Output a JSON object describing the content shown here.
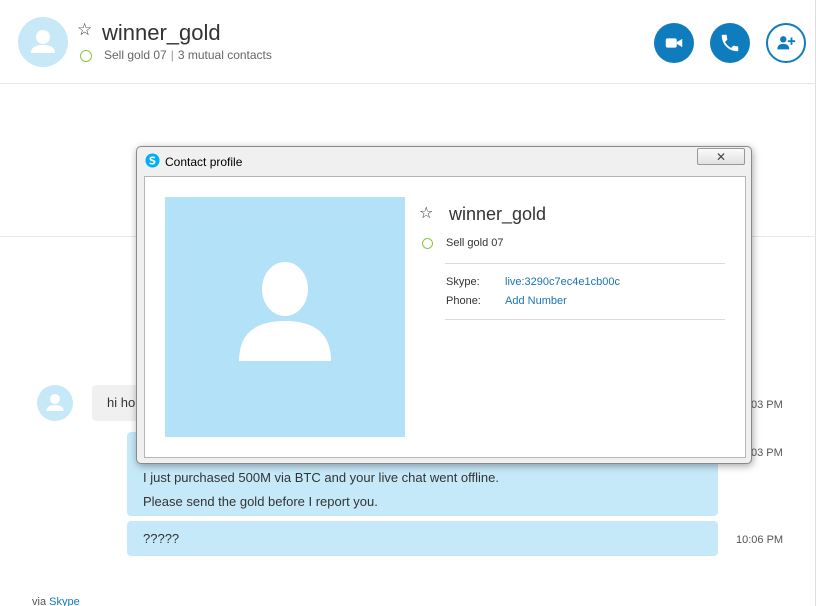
{
  "header": {
    "contact_name": "winner_gold",
    "mood": "Sell gold 07",
    "separator": "|",
    "mutual_contacts": "3 mutual contacts",
    "buttons": {
      "video_call": "video-camera-icon",
      "audio_call": "phone-icon",
      "add_people": "add-person-icon"
    }
  },
  "chat": {
    "incoming_preview": "hi ho",
    "messages": [
      {
        "lines": [
          "I just purchased 500M via BTC and your live chat went offline.",
          "Please send the gold before I report you."
        ]
      },
      {
        "lines": [
          "?????"
        ]
      }
    ],
    "times": [
      "03 PM",
      "03 PM",
      "10:06 PM"
    ],
    "via_prefix": "via",
    "via_link": "Skype"
  },
  "dialog": {
    "title": "Contact profile",
    "close_glyph": "✕",
    "name": "winner_gold",
    "mood": "Sell gold 07",
    "skype_label": "Skype:",
    "skype_value": "live:3290c7ec4e1cb00c",
    "phone_label": "Phone:",
    "phone_value": "Add Number"
  },
  "colors": {
    "accent": "#0f7cbe",
    "bubble_out": "#c6e9f9",
    "online": "#8dc63f",
    "avatar_bg": "#b3e1f7"
  }
}
